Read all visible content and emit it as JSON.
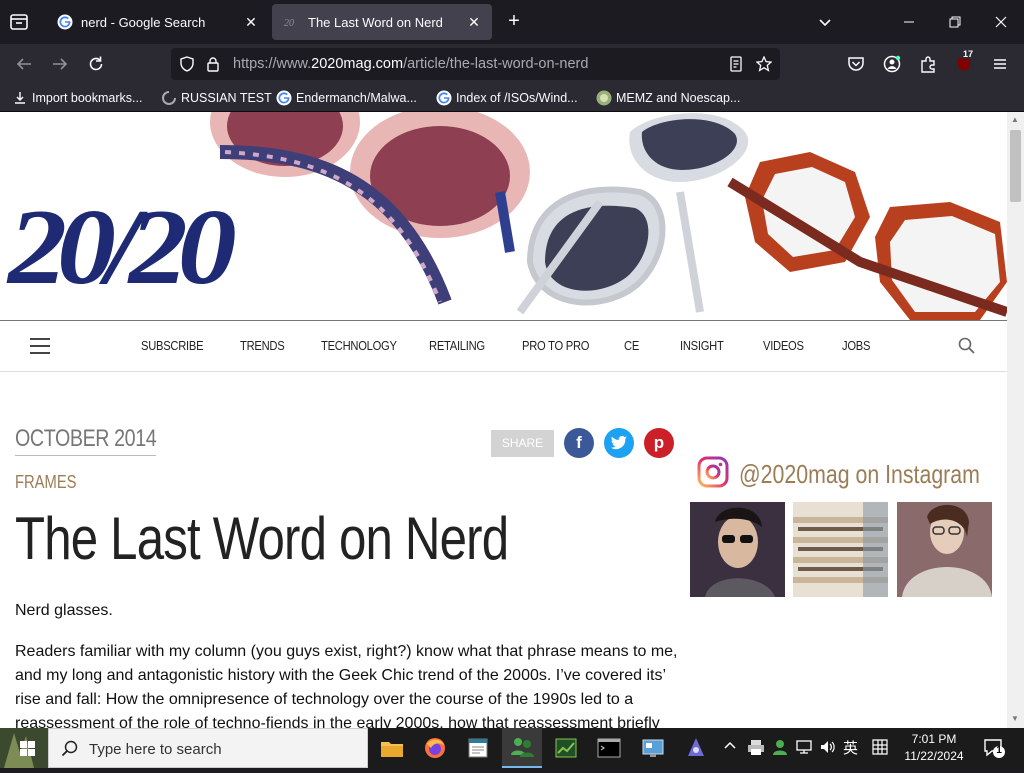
{
  "browser": {
    "tabs": [
      {
        "title": "nerd - Google Search",
        "active": false,
        "icon": "google-icon"
      },
      {
        "title": "The Last Word on Nerd",
        "active": true,
        "icon": "2020mag-icon"
      }
    ],
    "url_prefix": "https://www.",
    "url_host": "2020mag.com",
    "url_path": "/article/the-last-word-on-nerd",
    "extension_badge": "17",
    "bookmarks": [
      {
        "label": "Import bookmarks...",
        "icon": "import-icon"
      },
      {
        "label": "RUSSIAN TEST",
        "icon": "loading-icon"
      },
      {
        "label": "Endermanch/Malwa...",
        "icon": "google-icon"
      },
      {
        "label": "Index of /ISOs/Wind...",
        "icon": "google-icon"
      },
      {
        "label": "MEMZ and Noescap...",
        "icon": "memz-icon"
      }
    ]
  },
  "site": {
    "logo_text": "20/20",
    "nav": [
      "SUBSCRIBE",
      "TRENDS",
      "TECHNOLOGY",
      "RETAILING",
      "PRO TO PRO",
      "CE",
      "INSIGHT",
      "VIDEOS",
      "JOBS"
    ]
  },
  "article": {
    "date": "OCTOBER 2014",
    "category": "FRAMES",
    "headline": "The Last Word on Nerd",
    "share_label": "SHARE",
    "p1": "Nerd glasses.",
    "p2": "Readers familiar with my column (you guys exist, right?) know what that phrase means to me, and my long and antagonistic history with the Geek Chic trend of the 2000s. I’ve covered its’ rise and fall: How the omnipresence of technology over the course of the 1990s led to a reassessment of the role of techno-fiends in the early 2000s, how that reassessment briefly"
  },
  "sidebar": {
    "instagram_handle": "@2020mag on Instagram"
  },
  "taskbar": {
    "search_placeholder": "Type here to search",
    "ime_label": "英",
    "time": "7:01 PM",
    "date": "11/22/2024",
    "notification_count": "1"
  },
  "colors": {
    "logo": "#1e2a73",
    "accent_gold": "#9c7d57",
    "facebook": "#3b5998",
    "twitter": "#1da1f2",
    "pinterest": "#cb2027"
  }
}
